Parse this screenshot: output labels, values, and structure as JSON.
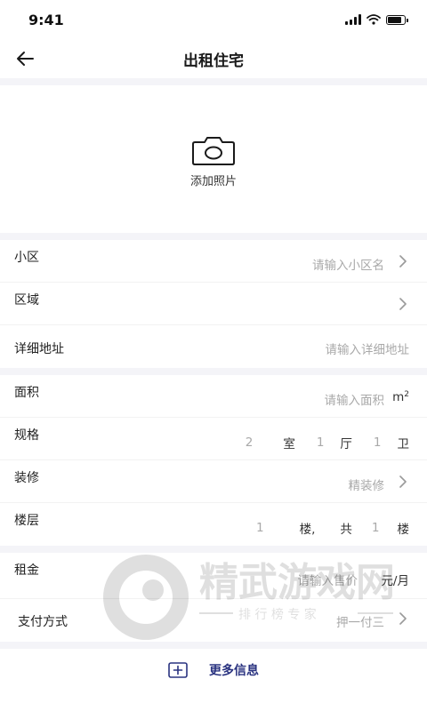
{
  "status": {
    "time": "9:41"
  },
  "nav": {
    "title": "出租住宅"
  },
  "photo": {
    "label": "添加照片"
  },
  "community": {
    "label": "小区",
    "placeholder": "请输入小区名"
  },
  "region": {
    "label": "区域"
  },
  "address": {
    "label": "详细地址",
    "placeholder": "请输入详细地址"
  },
  "area": {
    "label": "面积",
    "placeholder": "请输入面积",
    "unit": "m",
    "unit_sup": "2"
  },
  "layout": {
    "label": "规格",
    "rooms": "2",
    "rooms_unit": "室",
    "halls": "1",
    "halls_unit": "厅",
    "baths": "1",
    "baths_unit": "卫"
  },
  "decoration": {
    "label": "装修",
    "value": "精装修"
  },
  "floor": {
    "label": "楼层",
    "floor": "1",
    "floor_unit": "楼,",
    "total_prefix": "共",
    "total": "1",
    "total_unit": "楼"
  },
  "rent": {
    "label": "租金",
    "placeholder": "请输入售价",
    "unit": "元/月"
  },
  "payment": {
    "label": "支付方式",
    "value": "押一付三"
  },
  "more": {
    "label": "更多信息"
  },
  "watermark": {
    "title": "精武游戏网",
    "subtitle": "排 行 榜 专 家"
  },
  "colors": {
    "accent": "#2a3380",
    "placeholder": "#a9a9a9",
    "section_gap": "#f4f4f8"
  }
}
